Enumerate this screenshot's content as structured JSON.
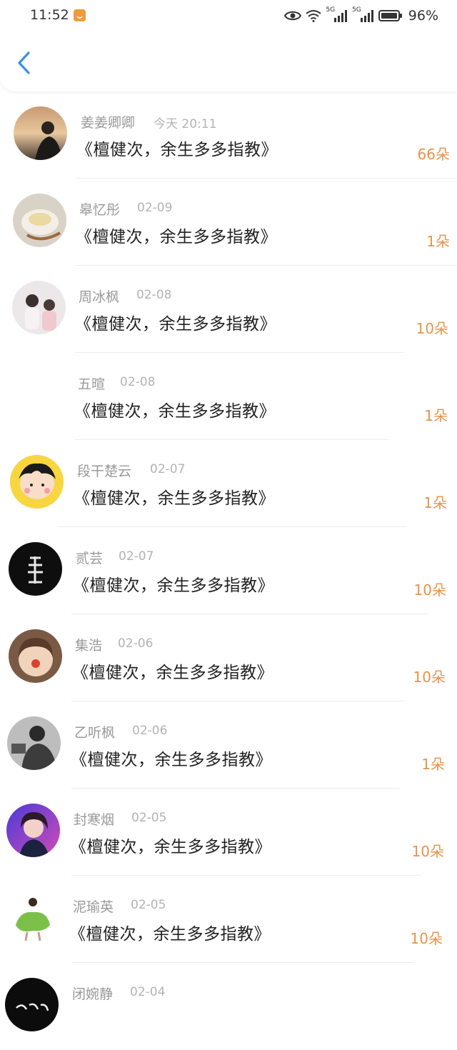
{
  "status": {
    "time": "11:52",
    "network1": "5G",
    "network2": "5G",
    "battery": "96%"
  },
  "nav": {
    "back_icon": "chevron-left-icon"
  },
  "colors": {
    "accent": "#e8934a",
    "back": "#3d8fe8",
    "name": "#999999"
  },
  "items": [
    {
      "name": "姜姜卿卿",
      "date": "今天 20:11",
      "title": "《檀健次，余生多多指教》",
      "flowers": "66朵"
    },
    {
      "name": "皋忆彤",
      "date": "02-09",
      "title": "《檀健次，余生多多指教》",
      "flowers": "1朵"
    },
    {
      "name": "周冰枫",
      "date": "02-08",
      "title": "《檀健次，余生多多指教》",
      "flowers": "10朵"
    },
    {
      "name": "五暄",
      "date": "02-08",
      "title": "《檀健次，余生多多指教》",
      "flowers": "1朵"
    },
    {
      "name": "段干楚云",
      "date": "02-07",
      "title": "《檀健次，余生多多指教》",
      "flowers": "1朵"
    },
    {
      "name": "贰芸",
      "date": "02-07",
      "title": "《檀健次，余生多多指教》",
      "flowers": "10朵"
    },
    {
      "name": "集浩",
      "date": "02-06",
      "title": "《檀健次，余生多多指教》",
      "flowers": "10朵"
    },
    {
      "name": "乙听枫",
      "date": "02-06",
      "title": "《檀健次，余生多多指教》",
      "flowers": "1朵"
    },
    {
      "name": "封寒烟",
      "date": "02-05",
      "title": "《檀健次，余生多多指教》",
      "flowers": "10朵"
    },
    {
      "name": "泥瑜英",
      "date": "02-05",
      "title": "《檀健次，余生多多指教》",
      "flowers": "10朵"
    },
    {
      "name": "闭婉静",
      "date": "02-04",
      "title": "",
      "flowers": ""
    }
  ]
}
